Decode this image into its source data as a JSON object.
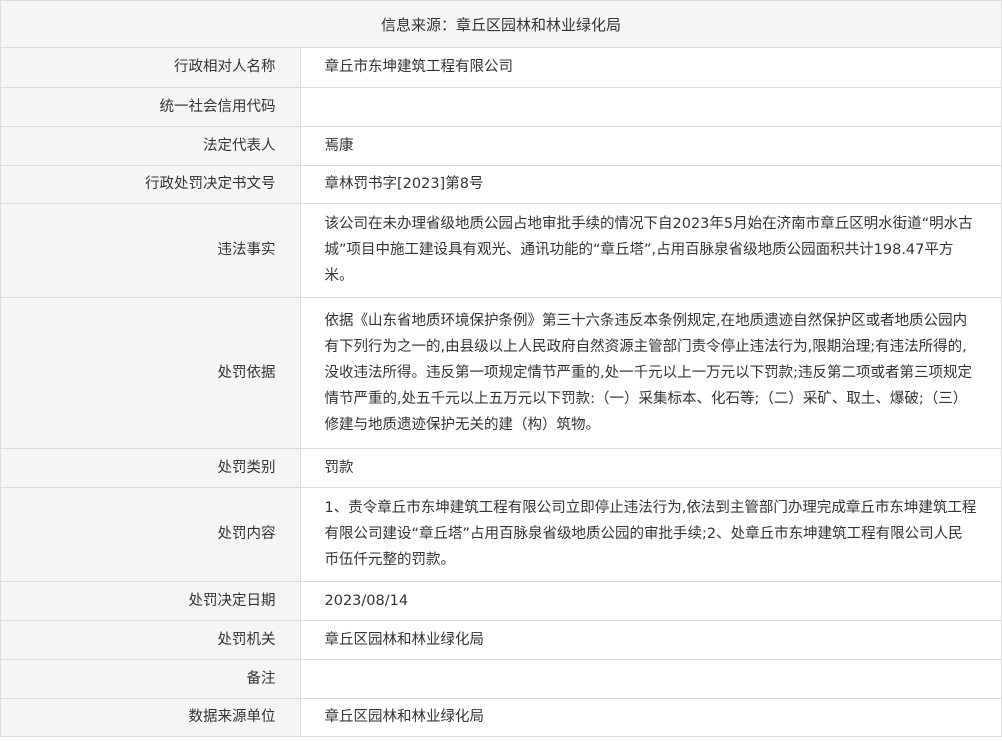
{
  "header": {
    "source_label": "信息来源：",
    "source_value": "章丘区园林和林业绿化局"
  },
  "rows": [
    {
      "label": "行政相对人名称",
      "value": "章丘市东坤建筑工程有限公司"
    },
    {
      "label": "统一社会信用代码",
      "value": ""
    },
    {
      "label": "法定代表人",
      "value": "焉康"
    },
    {
      "label": "行政处罚决定书文号",
      "value": "章林罚书字[2023]第8号"
    },
    {
      "label": "违法事实",
      "value": "该公司在未办理省级地质公园占地审批手续的情况下自2023年5月始在济南市章丘区明水街道“明水古城”项目中施工建设具有观光、通讯功能的“章丘塔”,占用百脉泉省级地质公园面积共计198.47平方米。"
    },
    {
      "label": "处罚依据",
      "value": "依据《山东省地质环境保护条例》第三十六条违反本条例规定,在地质遗迹自然保护区或者地质公园内有下列行为之一的,由县级以上人民政府自然资源主管部门责令停止违法行为,限期治理;有违法所得的,没收违法所得。违反第一项规定情节严重的,处一千元以上一万元以下罚款;违反第二项或者第三项规定情节严重的,处五千元以上五万元以下罚款:（一）采集标本、化石等;（二）采矿、取土、爆破;（三）修建与地质遗迹保护无关的建（构）筑物。"
    },
    {
      "label": "处罚类别",
      "value": "罚款"
    },
    {
      "label": "处罚内容",
      "value": "1、责令章丘市东坤建筑工程有限公司立即停止违法行为,依法到主管部门办理完成章丘市东坤建筑工程有限公司建设“章丘塔”占用百脉泉省级地质公园的审批手续;2、处章丘市东坤建筑工程有限公司人民币伍仟元整的罚款。"
    },
    {
      "label": "处罚决定日期",
      "value": "2023/08/14"
    },
    {
      "label": "处罚机关",
      "value": "章丘区园林和林业绿化局"
    },
    {
      "label": "备注",
      "value": ""
    },
    {
      "label": "数据来源单位",
      "value": "章丘区园林和林业绿化局"
    }
  ]
}
